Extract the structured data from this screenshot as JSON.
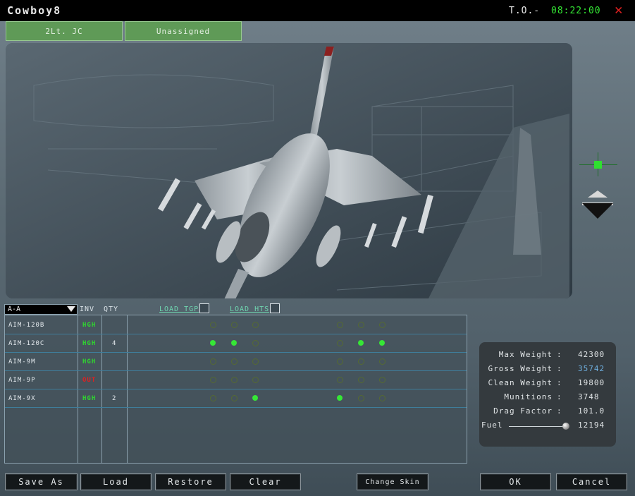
{
  "title": "Cowboy8",
  "to_label": "T.O.-",
  "clock": "08:22:00",
  "pilot_tabs": [
    "2Lt. JC",
    "Unassigned"
  ],
  "filter": {
    "value": "A-A"
  },
  "headers": {
    "inv": "INV",
    "qty": "QTY",
    "load_tgp": "LOAD TGP",
    "load_hts": "LOAD HTS"
  },
  "stores": [
    {
      "name": "AIM-120B",
      "inv": "HGH",
      "qty": "",
      "stations": [
        0,
        0,
        0,
        0,
        0,
        0
      ]
    },
    {
      "name": "AIM-120C",
      "inv": "HGH",
      "qty": "4",
      "stations": [
        1,
        1,
        0,
        0,
        1,
        1
      ]
    },
    {
      "name": "AIM-9M",
      "inv": "HGH",
      "qty": "",
      "stations": [
        0,
        0,
        0,
        0,
        0,
        0
      ]
    },
    {
      "name": "AIM-9P",
      "inv": "OUT",
      "qty": "",
      "stations": [
        0,
        0,
        0,
        0,
        0,
        0
      ]
    },
    {
      "name": "AIM-9X",
      "inv": "HGH",
      "qty": "2",
      "stations": [
        0,
        0,
        1,
        1,
        0,
        0
      ]
    }
  ],
  "stats": [
    {
      "label": "Max Weight",
      "value": "42300",
      "color": "#e0e4e6"
    },
    {
      "label": "Gross Weight",
      "value": "35742",
      "color": "#6fb0e0"
    },
    {
      "label": "Clean Weight",
      "value": "19800",
      "color": "#e0e4e6"
    },
    {
      "label": "Munitions",
      "value": "3748",
      "color": "#e0e4e6"
    },
    {
      "label": "Drag Factor",
      "value": "101.0",
      "color": "#e0e4e6"
    }
  ],
  "fuel": {
    "label": "Fuel",
    "value": "12194",
    "level": 1.0
  },
  "buttons": {
    "save_as": "Save As",
    "load": "Load",
    "restore": "Restore",
    "clear": "Clear",
    "change_skin": "Change Skin",
    "ok": "OK",
    "cancel": "Cancel"
  },
  "colors": {
    "inv_ok": "#2fd62f",
    "inv_out": "#e02020",
    "station_on": "#36e636"
  }
}
